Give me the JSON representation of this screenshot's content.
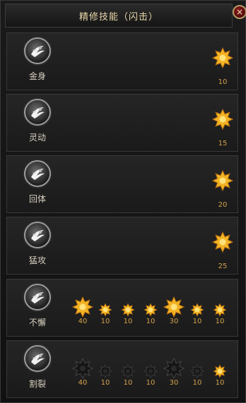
{
  "window": {
    "title": "精修技能（闪击）",
    "close_label": "×"
  },
  "skills": [
    {
      "name": "金身",
      "stars": [
        {
          "value": "10",
          "active": true
        }
      ]
    },
    {
      "name": "灵动",
      "stars": [
        {
          "value": "15",
          "active": true
        }
      ]
    },
    {
      "name": "回体",
      "stars": [
        {
          "value": "20",
          "active": true
        }
      ]
    },
    {
      "name": "猛攻",
      "stars": [
        {
          "value": "25",
          "active": true
        }
      ]
    },
    {
      "name": "不懈",
      "stars": [
        {
          "value": "40",
          "active": true
        },
        {
          "value": "10",
          "active": true
        },
        {
          "value": "10",
          "active": true
        },
        {
          "value": "10",
          "active": true
        },
        {
          "value": "30",
          "active": true
        },
        {
          "value": "10",
          "active": true
        },
        {
          "value": "10",
          "active": true
        }
      ]
    },
    {
      "name": "割裂",
      "stars": [
        {
          "value": "40",
          "active": false
        },
        {
          "value": "10",
          "active": false
        },
        {
          "value": "10",
          "active": false
        },
        {
          "value": "10",
          "active": false
        },
        {
          "value": "30",
          "active": false
        },
        {
          "value": "10",
          "active": false
        },
        {
          "value": "10",
          "active": true
        }
      ]
    }
  ],
  "colors": {
    "star_active": "#f0a020",
    "star_inactive": "#111111",
    "value_text": "#d4a24c",
    "title_text": "#e8d7a8"
  },
  "icons": {
    "skill": "dash-strike-icon",
    "star": "star-icon",
    "close": "close-icon"
  }
}
